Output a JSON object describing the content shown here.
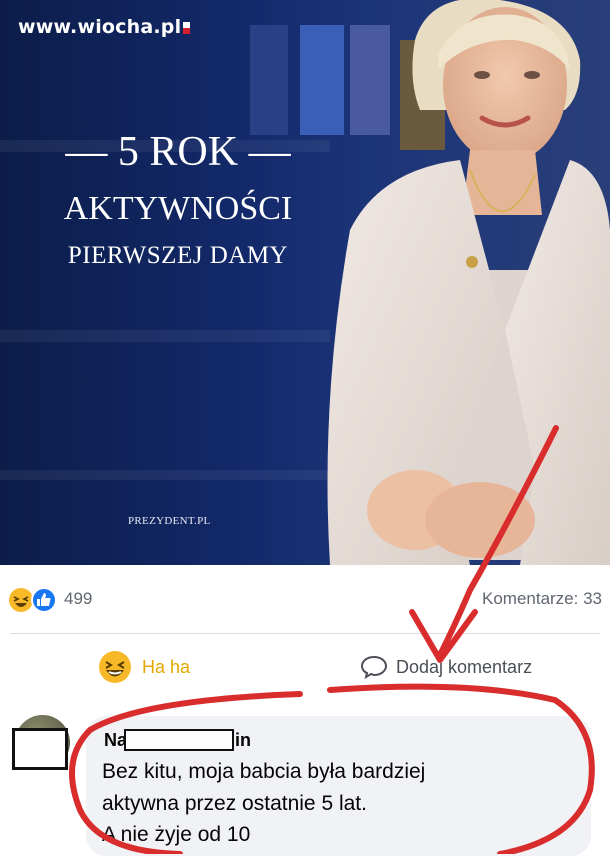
{
  "site": {
    "logo_text": "www.wiocha.pl"
  },
  "banner": {
    "title_line1": "— 5 ROK —",
    "title_line2": "AKTYWNOŚCI",
    "title_line3": "PIERWSZEJ DAMY",
    "watermark": "PREZYDENT.PL"
  },
  "stats": {
    "reactions_count": "499",
    "comments_label": "Komentarze: 33"
  },
  "actions": {
    "haha_label": "Ha ha",
    "comment_label": "Dodaj komentarz"
  },
  "comment": {
    "author_prefix": "Na",
    "author_suffix": "in",
    "lines": [
      "Bez kitu, moja babcia była bardziej",
      "aktywna przez ostatnie 5 lat.",
      "A nie żyje od 10"
    ]
  },
  "colors": {
    "annotation": "#d92c2c",
    "haha": "#f7b928",
    "like": "#1877f2",
    "banner_bg": "#13296a"
  },
  "icons": [
    "haha-icon",
    "like-icon",
    "comment-icon",
    "avatar"
  ]
}
